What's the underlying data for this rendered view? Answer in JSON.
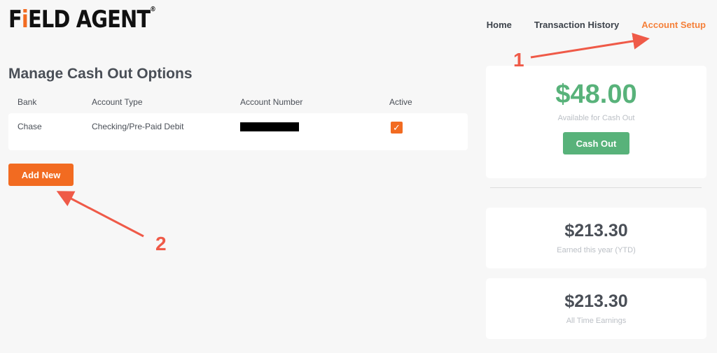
{
  "logo": {
    "text": "FIELD AGENT",
    "pre": "F",
    "i": "i",
    "post": "ELD AGENT",
    "reg": "®"
  },
  "nav": {
    "items": [
      "Home",
      "Transaction History",
      "Account Setup"
    ],
    "active": "Account Setup"
  },
  "page_title": "Manage Cash Out Options",
  "table": {
    "headers": [
      "Bank",
      "Account Type",
      "Account Number",
      "Active"
    ],
    "rows": [
      {
        "bank": "Chase",
        "account_type": "Checking/Pre-Paid Debit",
        "account_number": "[redacted]",
        "active": true
      }
    ]
  },
  "add_new_label": "Add New",
  "cards": {
    "available": {
      "amount": "$48.00",
      "label": "Available for Cash Out",
      "button": "Cash Out"
    },
    "ytd": {
      "amount": "$213.30",
      "label": "Earned this year (YTD)"
    },
    "all_time": {
      "amount": "$213.30",
      "label": "All Time Earnings"
    }
  },
  "annotations": [
    "1",
    "2"
  ],
  "colors": {
    "accent": "#f26b21",
    "green": "#58b27a",
    "annotation": "#ef5a48"
  }
}
